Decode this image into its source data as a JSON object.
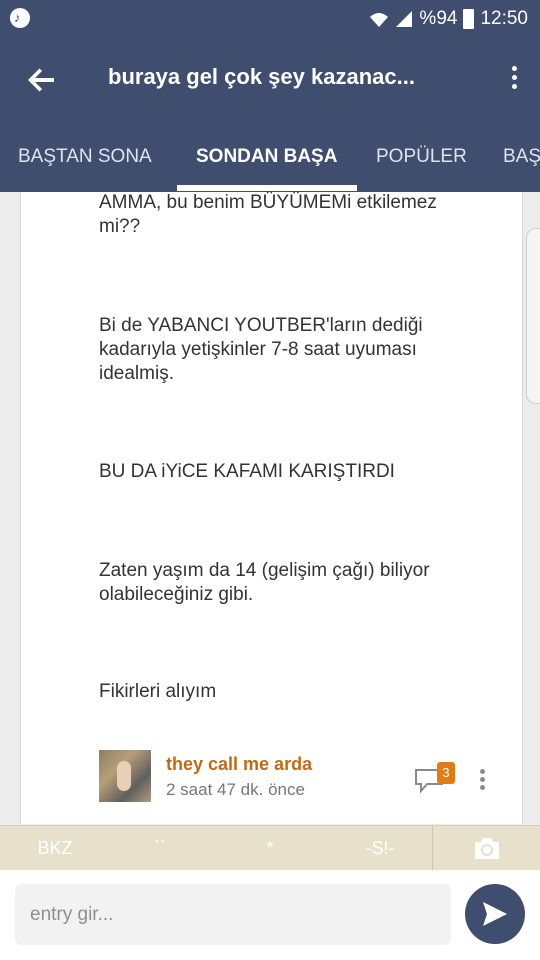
{
  "status_bar": {
    "battery": "%94",
    "time": "12:50",
    "music_icon": "music-note-icon",
    "wifi_icon": "wifi-icon",
    "signal_icon": "signal-icon",
    "battery_icon": "battery-icon"
  },
  "header": {
    "title": "buraya gel çok şey kazanac...",
    "back_icon": "back-arrow-icon",
    "menu_icon": "more-vert-icon"
  },
  "tabs": [
    {
      "label": "BAŞTAN SONA"
    },
    {
      "label": "SONDAN BAŞA"
    },
    {
      "label": "POPÜLER"
    },
    {
      "label": "BAŞ"
    }
  ],
  "entry": {
    "paragraphs": [
      "AMMA, bu benim BÜYÜMEMi etkilemez mi??",
      "Bi de YABANCI YOUTBER'ların dediği kadarıyla yetişkinler 7-8 saat uyuması idealmiş.",
      "BU DA iYiCE KAFAMI KARIŞTIRDI",
      "Zaten yaşım da 14 (gelişim çağı) biliyor olabileceğiniz gibi.",
      "Fikirleri alıyım"
    ],
    "author": "they call me arda",
    "time": "2 saat 47 dk. önce",
    "comment_count": "3"
  },
  "format_bar": {
    "bkz": "BKZ",
    "backtick": "``",
    "asterisk": "*",
    "spoiler": "-S!-",
    "camera_icon": "camera-icon"
  },
  "input": {
    "placeholder": "entry gir...",
    "value": ""
  },
  "colors": {
    "primary": "#3f4d6e",
    "author": "#c06a16",
    "badge": "#e27b14",
    "format_bar": "#e7e1cb"
  }
}
